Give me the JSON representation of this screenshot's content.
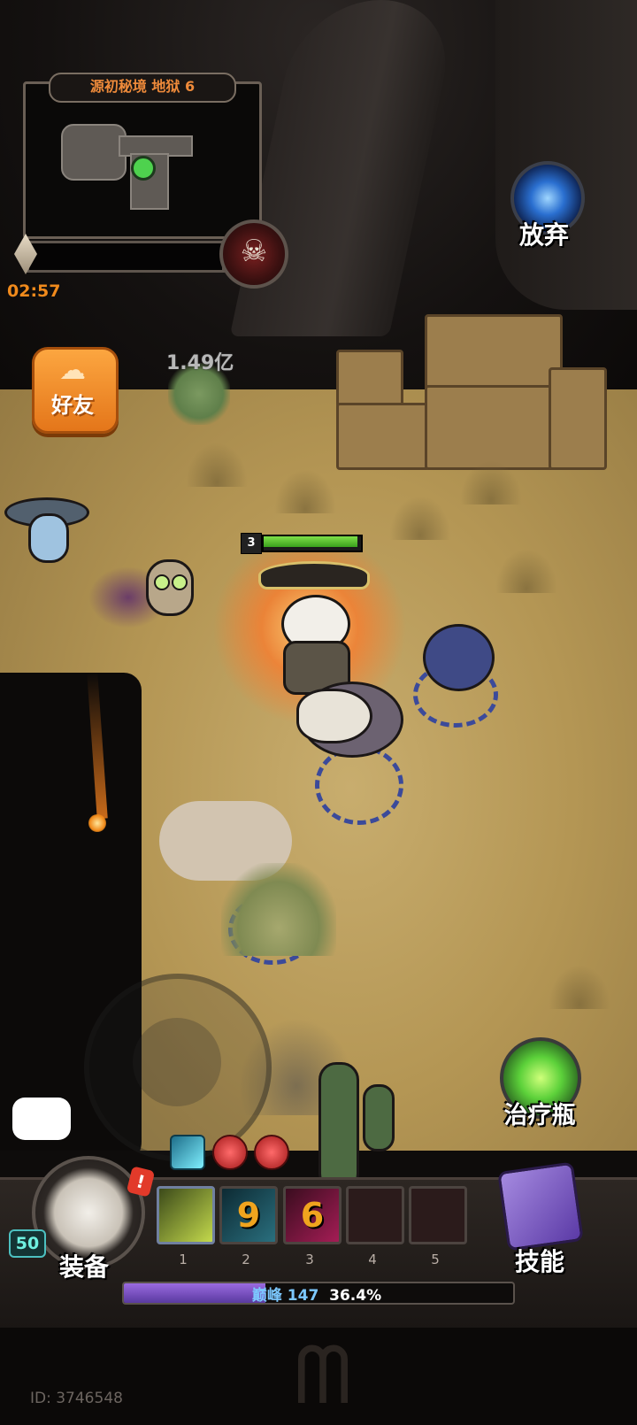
{
  "dungeon": {
    "title": "源初秘境 地狱 6",
    "timer": "02:57"
  },
  "minimap": {
    "player_marker": "player-dot"
  },
  "boss": {
    "icon": "horned-skull-icon",
    "skull_glyph": "☠"
  },
  "abandon": {
    "label": "放弃",
    "icon": "portal-icon"
  },
  "friends": {
    "label": "好友",
    "icon": "cloud-icon",
    "glyph": "☁"
  },
  "combat_power": "1.49亿",
  "hero": {
    "hp_level": "3",
    "hp_fraction": 1.0
  },
  "potion": {
    "label": "治疗瓶",
    "icon": "potion-flask-icon"
  },
  "chat": {
    "icon": "cat-face-emoji-icon",
    "glyph": "😼"
  },
  "buffs": [
    {
      "name": "lightning-buff-icon"
    },
    {
      "name": "red-orb-buff-icon"
    },
    {
      "name": "red-orb-buff-icon"
    }
  ],
  "skill_slots": [
    {
      "number": "1",
      "value": "",
      "icon": "blade-skill-icon"
    },
    {
      "number": "2",
      "value": "9",
      "icon": "cyan-skill-icon"
    },
    {
      "number": "3",
      "value": "6",
      "icon": "magenta-skill-icon"
    },
    {
      "number": "4",
      "value": ""
    },
    {
      "number": "5",
      "value": ""
    }
  ],
  "equipment": {
    "label": "装备",
    "level": "50",
    "alert": "!"
  },
  "skills": {
    "label": "技能",
    "icon": "spellbook-icon"
  },
  "experience": {
    "rank_label": "巅峰 147",
    "percent_label": "36.4%",
    "fill_fraction": 0.364
  },
  "player": {
    "id_label": "ID: 3746548"
  },
  "colors": {
    "accent_orange": "#f08a1c",
    "xp_purple": "#7a4ad0",
    "hp_green": "#5bc834"
  }
}
